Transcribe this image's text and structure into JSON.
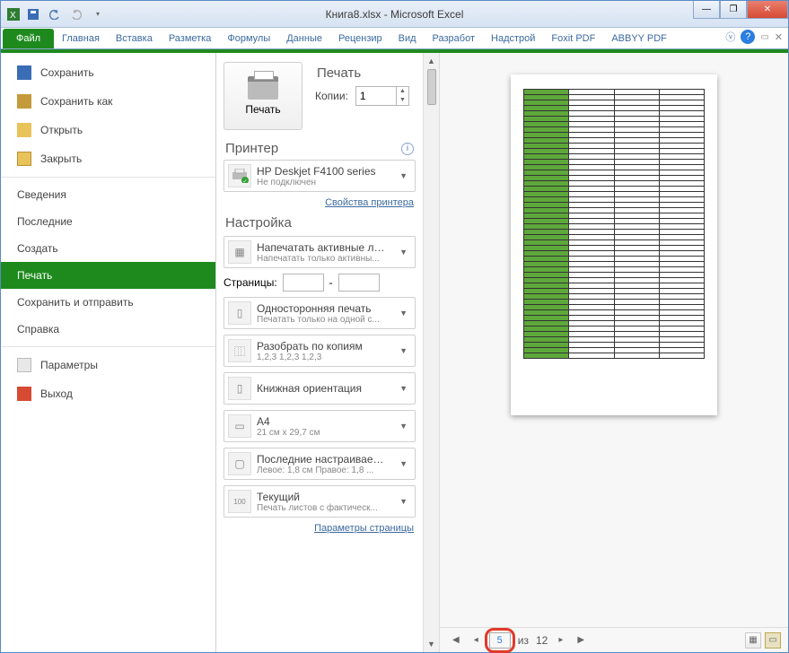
{
  "window": {
    "title": "Книга8.xlsx - Microsoft Excel"
  },
  "ribbon": {
    "file": "Файл",
    "tabs": [
      "Главная",
      "Вставка",
      "Разметка",
      "Формулы",
      "Данные",
      "Рецензир",
      "Вид",
      "Разработ",
      "Надстрой",
      "Foxit PDF",
      "ABBYY PDF"
    ]
  },
  "backstage": {
    "save": "Сохранить",
    "save_as": "Сохранить как",
    "open": "Открыть",
    "close": "Закрыть",
    "info": "Сведения",
    "recent": "Последние",
    "new": "Создать",
    "print": "Печать",
    "save_send": "Сохранить и отправить",
    "help": "Справка",
    "options": "Параметры",
    "exit": "Выход"
  },
  "print_panel": {
    "print_heading": "Печать",
    "print_button": "Печать",
    "copies_label": "Копии:",
    "copies_value": "1",
    "printer_heading": "Принтер",
    "printer_name": "HP Deskjet F4100 series",
    "printer_status": "Не подключен",
    "printer_properties": "Свойства принтера",
    "settings_heading": "Настройка",
    "opt_print_what": {
      "t1": "Напечатать активные листы",
      "t2": "Напечатать только активны..."
    },
    "pages_label": "Страницы:",
    "pages_from": "",
    "pages_sep": "-",
    "pages_to": "",
    "opt_sides": {
      "t1": "Односторонняя печать",
      "t2": "Печатать только на одной с..."
    },
    "opt_collate": {
      "t1": "Разобрать по копиям",
      "t2": "1,2,3   1,2,3   1,2,3"
    },
    "opt_orientation": {
      "t1": "Книжная ориентация",
      "t2": ""
    },
    "opt_paper": {
      "t1": "A4",
      "t2": "21 см x 29,7 см"
    },
    "opt_margins": {
      "t1": "Последние настраиваемые ...",
      "t2": "Левое: 1,8 см   Правое: 1,8 ..."
    },
    "opt_scaling": {
      "t1": "Текущий",
      "t2": "Печать листов с фактическ..."
    },
    "page_setup": "Параметры страницы"
  },
  "preview": {
    "current_page": "5",
    "of_label": "из",
    "total_pages": "12"
  }
}
